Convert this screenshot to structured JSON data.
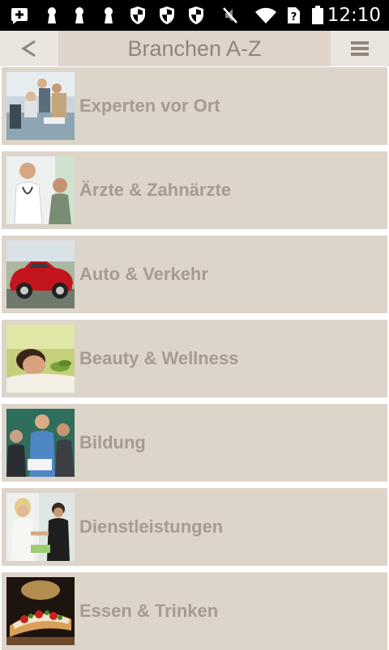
{
  "status_bar": {
    "time": "12:10",
    "icons": [
      "plus-notification-icon",
      "keyhole-icon",
      "keyhole-icon",
      "keyhole-icon",
      "shield-icon",
      "shield-icon",
      "shield-icon",
      "mute-icon",
      "wifi-icon",
      "sim-unknown-icon",
      "battery-icon"
    ]
  },
  "header": {
    "title": "Branchen A-Z",
    "back_label": "<",
    "menu_icon": "hamburger-menu-icon"
  },
  "categories": [
    {
      "label": "Experten vor Ort",
      "image": "business-meeting-photo"
    },
    {
      "label": "Ärzte & Zahnärzte",
      "image": "doctor-photo"
    },
    {
      "label": "Auto & Verkehr",
      "image": "red-car-photo"
    },
    {
      "label": "Beauty & Wellness",
      "image": "spa-photo"
    },
    {
      "label": "Bildung",
      "image": "classroom-photo"
    },
    {
      "label": "Dienstleistungen",
      "image": "handshake-photo"
    },
    {
      "label": "Essen & Trinken",
      "image": "pizza-photo"
    }
  ],
  "colors": {
    "header_bg": "#ded4cb",
    "button_bg": "#ebe5df",
    "item_bg": "#ddd4ca",
    "item_text": "#a69b92",
    "title_text": "#8f857d"
  }
}
